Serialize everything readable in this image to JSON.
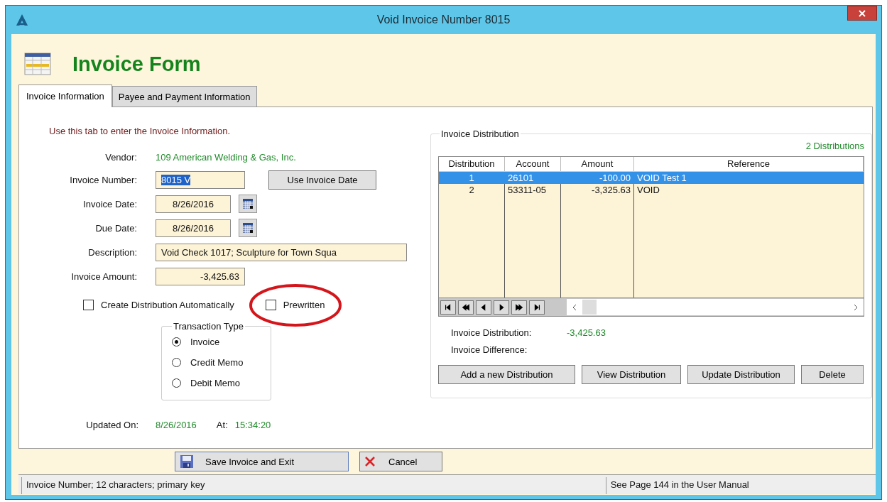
{
  "window": {
    "title": "Void Invoice Number 8015"
  },
  "form": {
    "title": "Invoice Form"
  },
  "tabs": [
    {
      "label": "Invoice Information",
      "selected": true
    },
    {
      "label": "Payee and Payment Information",
      "selected": false
    }
  ],
  "instructions": "Use this tab to enter the Invoice Information.",
  "vendor": {
    "label": "Vendor:",
    "value": "109  American Welding & Gas, Inc."
  },
  "fields": [
    {
      "kind": "input",
      "label": "Invoice Number:",
      "value": "8015 V",
      "text_selected": true,
      "button": "Use Invoice Date"
    },
    {
      "kind": "date",
      "label": "Invoice Date:",
      "value": "8/26/2016"
    },
    {
      "kind": "date",
      "label": "Due Date:",
      "value": "8/26/2016"
    },
    {
      "kind": "wide",
      "label": "Description:",
      "value": "Void Check 1017; Sculpture for Town Squa"
    },
    {
      "kind": "amount",
      "label": "Invoice Amount:",
      "value": "-3,425.63"
    }
  ],
  "checkboxes": [
    {
      "label": "Create Distribution Automatically",
      "checked": false,
      "circled": false
    },
    {
      "label": "Prewritten",
      "checked": false,
      "circled": true
    }
  ],
  "transaction_type": {
    "title": "Transaction Type",
    "options": [
      {
        "label": "Invoice",
        "selected": true
      },
      {
        "label": "Credit Memo",
        "selected": false
      },
      {
        "label": "Debit Memo",
        "selected": false
      }
    ]
  },
  "updated": {
    "label": "Updated On:",
    "date": "8/26/2016",
    "at_label": "At:",
    "time": "15:34:20"
  },
  "distribution": {
    "title": "Invoice Distribution",
    "count": "2  Distributions",
    "columns": [
      "Distribution",
      "Account",
      "Amount",
      "Reference"
    ],
    "rows": [
      {
        "cells": [
          "1",
          "26101",
          "-100.00",
          "VOID Test 1"
        ],
        "selected": true
      },
      {
        "cells": [
          "2",
          "53311-05",
          "-3,325.63",
          "VOID"
        ],
        "selected": false
      }
    ],
    "summary": [
      {
        "label": "Invoice Distribution:",
        "value": "-3,425.63"
      },
      {
        "label": "Invoice Difference:"
      }
    ],
    "buttons": [
      "Add a new Distribution",
      "View Distribution",
      "Update Distribution",
      "Delete"
    ]
  },
  "footer_buttons": [
    {
      "kind": "save",
      "label": "Save Invoice and Exit"
    },
    {
      "kind": "cancel",
      "label": "Cancel"
    }
  ],
  "status_bar": [
    "Invoice Number; 12 characters; primary key",
    "See Page 144 in the User Manual"
  ]
}
